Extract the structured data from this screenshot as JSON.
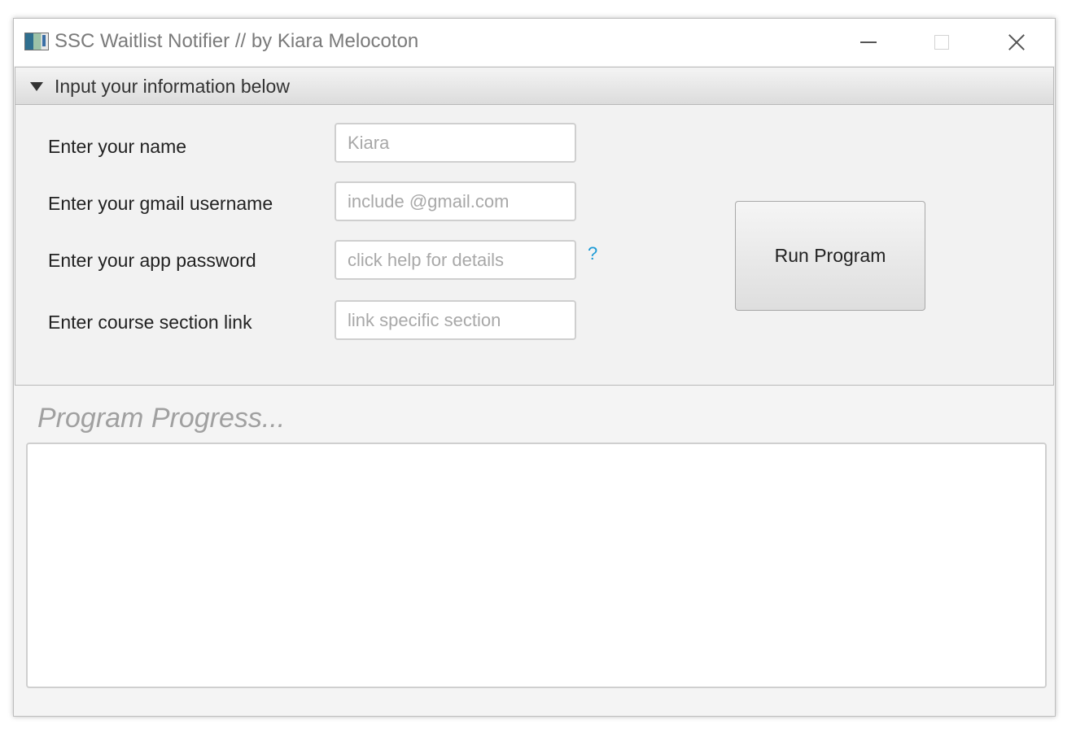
{
  "window": {
    "title": "SSC Waitlist Notifier // by Kiara Melocoton",
    "controls": [
      "minimize",
      "maximize",
      "close"
    ]
  },
  "section": {
    "title": "Input your information below",
    "expanded": true
  },
  "form": {
    "name": {
      "label": "Enter your name",
      "placeholder": "Kiara"
    },
    "gmail": {
      "label": "Enter your gmail username",
      "placeholder": "include @gmail.com"
    },
    "password": {
      "label": "Enter your app password",
      "placeholder": "click help for details"
    },
    "course": {
      "label": "Enter course section link",
      "placeholder": "link specific section"
    },
    "help_link": "?"
  },
  "run_button": {
    "label": "Run Program"
  },
  "progress": {
    "label": "Program Progress...",
    "content": ""
  },
  "colors": {
    "help_link": "#1b9ad6",
    "window_bg": "#f4f4f4"
  }
}
